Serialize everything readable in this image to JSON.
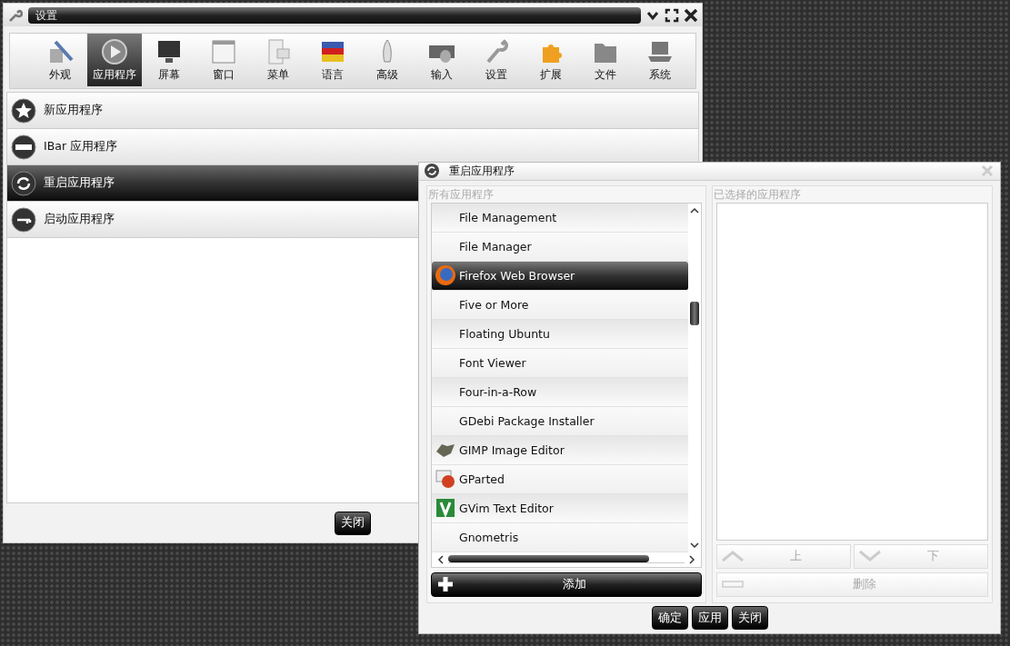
{
  "main_window": {
    "title": "设置",
    "toolbar": [
      {
        "label": "外观",
        "selected": false
      },
      {
        "label": "应用程序",
        "selected": true
      },
      {
        "label": "屏幕",
        "selected": false
      },
      {
        "label": "窗口",
        "selected": false
      },
      {
        "label": "菜单",
        "selected": false
      },
      {
        "label": "语言",
        "selected": false
      },
      {
        "label": "高级",
        "selected": false
      },
      {
        "label": "输入",
        "selected": false
      },
      {
        "label": "设置",
        "selected": false
      },
      {
        "label": "扩展",
        "selected": false
      },
      {
        "label": "文件",
        "selected": false
      },
      {
        "label": "系统",
        "selected": false
      }
    ],
    "items": [
      {
        "label": "新应用程序",
        "selected": false
      },
      {
        "label": "IBar 应用程序",
        "selected": false
      },
      {
        "label": "重启应用程序",
        "selected": true
      },
      {
        "label": "启动应用程序",
        "selected": false
      }
    ],
    "close_button": "关闭"
  },
  "dialog": {
    "title": "重启应用程序",
    "all_apps": {
      "heading": "所有应用程序",
      "items": [
        {
          "label": "File Management",
          "selected": false
        },
        {
          "label": "File Manager",
          "selected": false
        },
        {
          "label": "Firefox Web Browser",
          "selected": true
        },
        {
          "label": "Five or More",
          "selected": false
        },
        {
          "label": "Floating Ubuntu",
          "selected": false
        },
        {
          "label": "Font Viewer",
          "selected": false
        },
        {
          "label": "Four-in-a-Row",
          "selected": false
        },
        {
          "label": "GDebi Package Installer",
          "selected": false
        },
        {
          "label": "GIMP Image Editor",
          "selected": false
        },
        {
          "label": "GParted",
          "selected": false
        },
        {
          "label": "GVim Text Editor",
          "selected": false
        },
        {
          "label": "Gnometris",
          "selected": false
        }
      ],
      "add_button": "添加"
    },
    "selected_apps": {
      "heading": "已选择的应用程序",
      "buttons": [
        {
          "label": "上",
          "disabled": true
        },
        {
          "label": "下",
          "disabled": true
        },
        {
          "label": "删除",
          "disabled": true
        }
      ]
    },
    "footer_buttons": [
      "确定",
      "应用",
      "关闭"
    ]
  }
}
